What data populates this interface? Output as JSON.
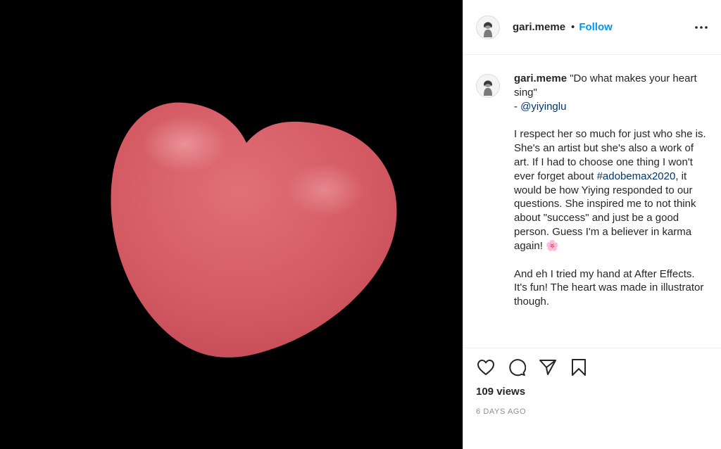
{
  "post": {
    "username": "gari.meme",
    "separator": "•",
    "follow_label": "Follow",
    "more_icon": "more-horizontal-icon"
  },
  "caption": {
    "username": "gari.meme",
    "quote": " \"Do what makes your heart sing\"",
    "dash": "- ",
    "mention": "@yiyinglu",
    "para1_a": "I respect her so much for just who she is. She's an artist but she's also a work of art. If I had to choose one thing I won't ever forget about ",
    "hashtag": "#adobemax2020",
    "para1_b": ", it would be how Yiying responded to our questions. She inspired me to not think about \"success\" and just be a good person. Guess I'm a believer in karma again! ",
    "emoji": "🌸",
    "para2": "And eh I tried my hand at After Effects. It's fun! The heart was made in illustrator though."
  },
  "actions": {
    "like_icon": "heart-outline-icon",
    "comment_icon": "comment-icon",
    "share_icon": "share-icon",
    "save_icon": "bookmark-icon"
  },
  "stats": {
    "views": "109 views",
    "date": "6 DAYS AGO"
  },
  "colors": {
    "heart": "#d45a63",
    "link": "#00376b",
    "follow": "#0095f6"
  }
}
